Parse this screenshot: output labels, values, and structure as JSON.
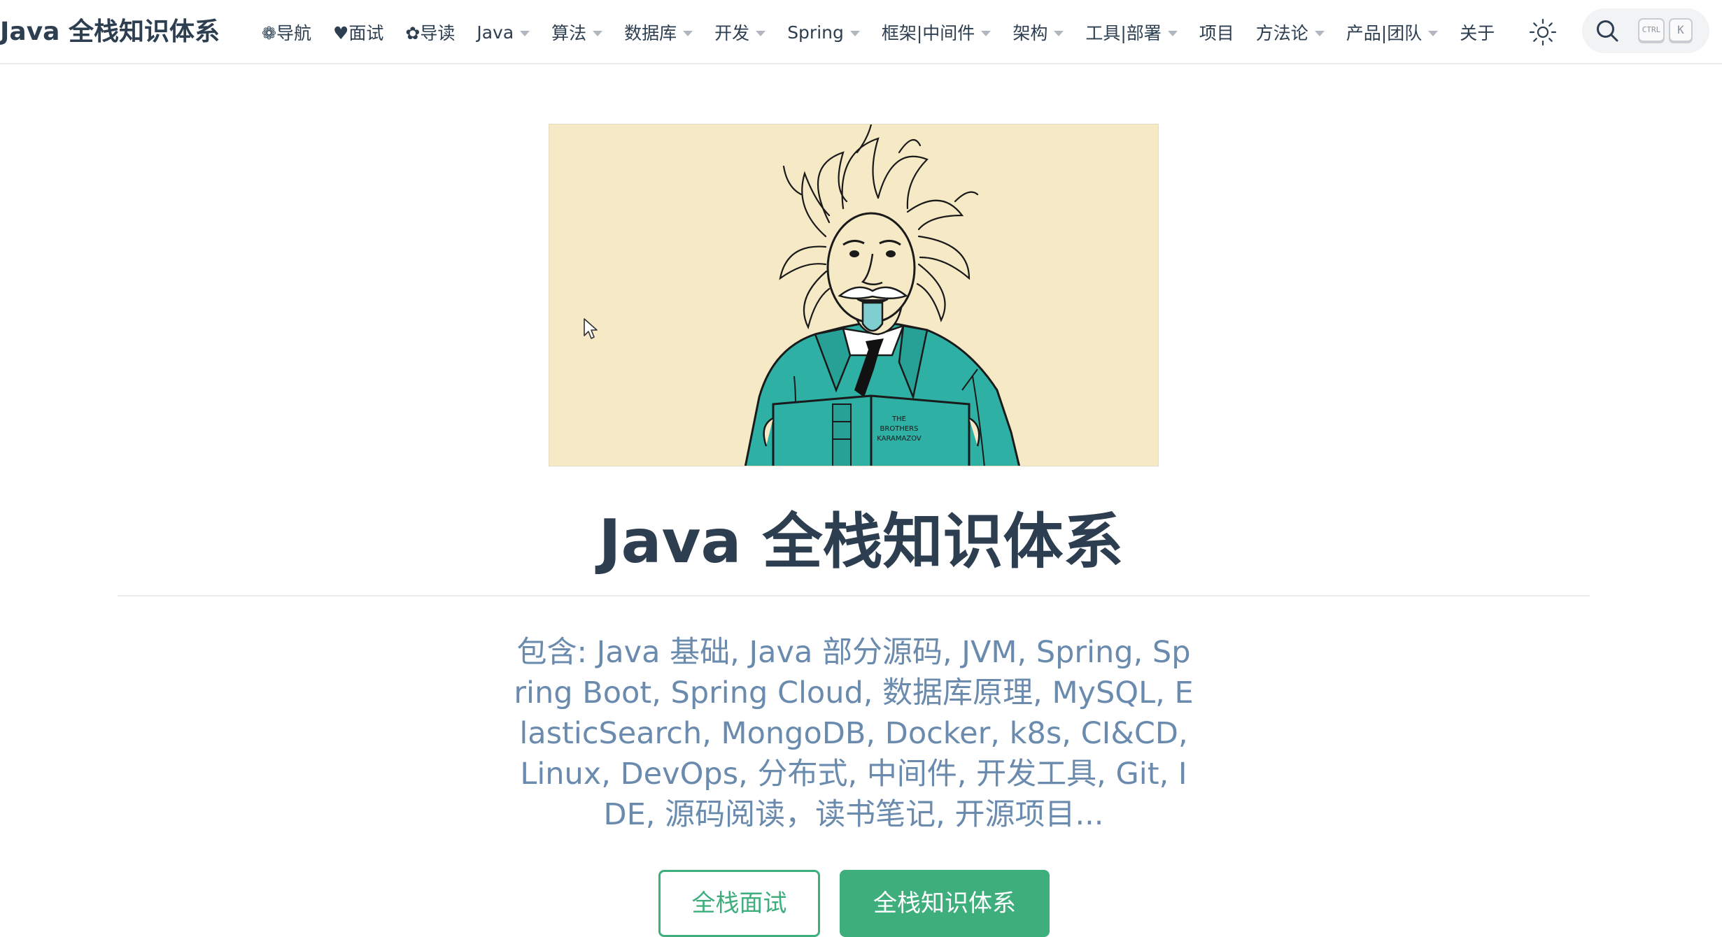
{
  "navbar": {
    "brand": "Java 全栈知识体系",
    "items": [
      {
        "label": "❁导航",
        "dropdown": false
      },
      {
        "label": "♥面试",
        "dropdown": false
      },
      {
        "label": "✿导读",
        "dropdown": false
      },
      {
        "label": "Java",
        "dropdown": true
      },
      {
        "label": "算法",
        "dropdown": true
      },
      {
        "label": "数据库",
        "dropdown": true
      },
      {
        "label": "开发",
        "dropdown": true
      },
      {
        "label": "Spring",
        "dropdown": true
      },
      {
        "label": "框架|中间件",
        "dropdown": true
      },
      {
        "label": "架构",
        "dropdown": true
      },
      {
        "label": "工具|部署",
        "dropdown": true
      },
      {
        "label": "项目",
        "dropdown": false
      },
      {
        "label": "方法论",
        "dropdown": true
      },
      {
        "label": "产品|团队",
        "dropdown": true
      },
      {
        "label": "关于",
        "dropdown": false
      }
    ],
    "theme_icon": "sun-icon",
    "search": {
      "icon": "search-icon",
      "kbd_ctrl": "CTRL",
      "kbd_k": "K"
    }
  },
  "hero": {
    "image_alt": "einstein-illustration",
    "book_title_line1": "THE",
    "book_title_line2": "BROTHERS",
    "book_title_line3": "KARAMAZOV",
    "title": "Java 全栈知识体系",
    "description": "包含: Java 基础, Java 部分源码, JVM, Spring, Spring Boot, Spring Cloud, 数据库原理, MySQL, ElasticSearch, MongoDB, Docker, k8s, CI&CD, Linux, DevOps, 分布式, 中间件, 开发工具, Git, IDE, 源码阅读，读书笔记, 开源项目...",
    "buttons": {
      "secondary": "全栈面试",
      "primary": "全栈知识体系"
    }
  },
  "colors": {
    "accent": "#3eaf7c",
    "text": "#2c3e50",
    "description": "#6a8bad",
    "image_bg": "#f6e9c6",
    "coat": "#2fb0a5"
  }
}
